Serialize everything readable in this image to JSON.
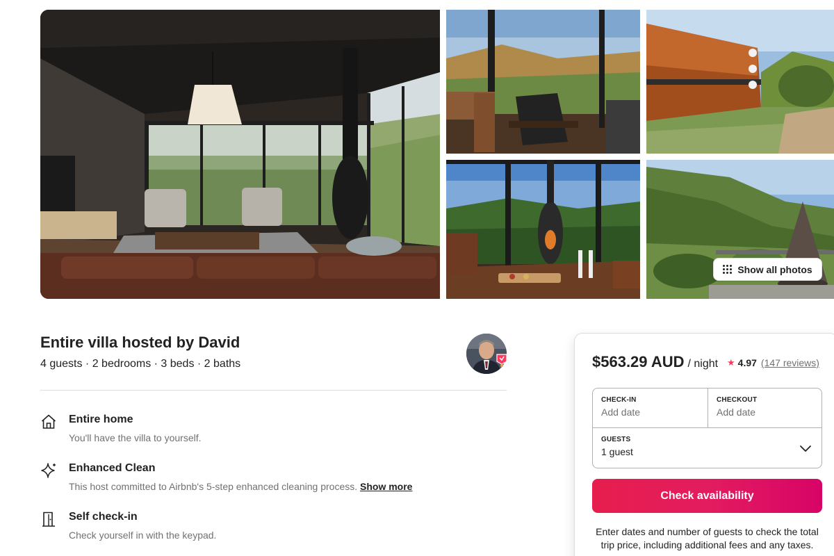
{
  "gallery": {
    "show_all_label": "Show all photos",
    "photos": [
      {
        "name": "living-room"
      },
      {
        "name": "window-view-armchair"
      },
      {
        "name": "villa-exterior"
      },
      {
        "name": "fireplace-wine"
      },
      {
        "name": "valley-view"
      }
    ]
  },
  "listing": {
    "title": "Entire villa hosted by David",
    "summary": "4 guests · 2 bedrooms · 3 beds · 2 baths",
    "features": [
      {
        "icon": "home-icon",
        "title": "Entire home",
        "description": "You'll have the villa to yourself."
      },
      {
        "icon": "sparkle-icon",
        "title": "Enhanced Clean",
        "description": "This host committed to Airbnb's 5-step enhanced cleaning process.",
        "link": "Show more"
      },
      {
        "icon": "door-icon",
        "title": "Self check-in",
        "description": "Check yourself in with the keypad."
      }
    ]
  },
  "booking": {
    "price": "$563.29 AUD",
    "per": "/ night",
    "star": "★",
    "rating": "4.97",
    "reviews": "(147 reviews)",
    "checkin_label": "CHECK-IN",
    "checkin_value": "Add date",
    "checkout_label": "CHECKOUT",
    "checkout_value": "Add date",
    "guests_label": "GUESTS",
    "guests_value": "1 guest",
    "button": "Check availability",
    "note": "Enter dates and number of guests to check the total trip price, including additional fees and any taxes."
  },
  "colors": {
    "brand": "#ff385c",
    "text": "#222222",
    "muted": "#717171",
    "border": "#dddddd"
  }
}
